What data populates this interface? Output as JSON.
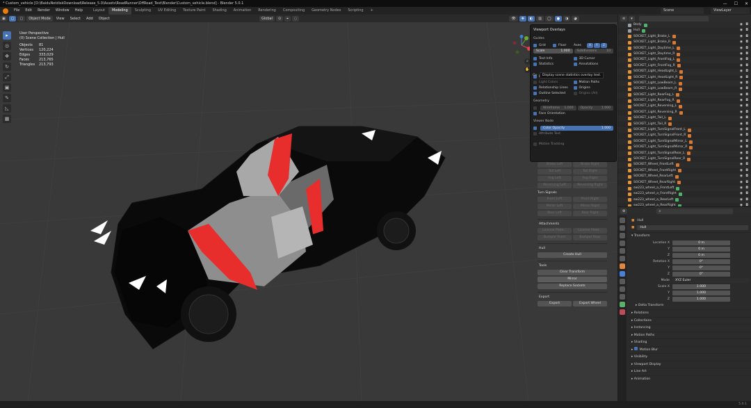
{
  "window": {
    "title": "* Custom_vehicle [D:\\BaiduNetdiskDownload\\Release_5.0\\Assets\\RoadRunner\\OffRoad_Test\\Blender\\Custom_vehicle.blend] - Blender 5.0.1",
    "minimize": "—",
    "maximize": "☐",
    "close": "✕"
  },
  "menu": [
    "File",
    "Edit",
    "Render",
    "Window",
    "Help"
  ],
  "workspaces": [
    "Layout",
    "Modeling",
    "Sculpting",
    "UV Editing",
    "Texture Paint",
    "Shading",
    "Animation",
    "Rendering",
    "Compositing",
    "Geometry Nodes",
    "Scripting"
  ],
  "active_workspace": "Modeling",
  "add_tab": "+",
  "scene": "Scene",
  "view_layer": "ViewLayer",
  "viewport_header": {
    "mode": "Object Mode",
    "menus": [
      "View",
      "Select",
      "Add",
      "Object"
    ],
    "orientation": "Global"
  },
  "stats": {
    "view": "User Perspective",
    "collection": "(0) Scene Collection | Hull",
    "rows": [
      {
        "k": "Objects",
        "v": "81"
      },
      {
        "k": "Vertices",
        "v": "120,224"
      },
      {
        "k": "Edges",
        "v": "333,029"
      },
      {
        "k": "Faces",
        "v": "213,765"
      },
      {
        "k": "Triangles",
        "v": "213,793"
      }
    ]
  },
  "tools": [
    "▸",
    "◎",
    "✥",
    "↻",
    "⤢",
    "▣",
    "✎",
    "◺",
    "▦"
  ],
  "overlays": {
    "title": "Viewport Overlays",
    "guides_label": "Guides",
    "grid": "Grid",
    "floor": "Floor",
    "axes": "Axes",
    "axis_x": "X",
    "axis_y": "Y",
    "axis_z": "Z",
    "scale_label": "Scale",
    "scale_value": "1.000",
    "subdivisions_label": "Subdivisions",
    "subdivisions_value": "10",
    "text_info": "Text Info",
    "cursor_3d": "3D Cursor",
    "statistics": "Statistics",
    "annotations": "Annotations",
    "extras": "Extras",
    "bones": "Bones",
    "light_colors": "Light Colors",
    "motion_paths": "Motion Paths",
    "relationship_lines": "Relationship Lines",
    "origins": "Origins",
    "outline_selected": "Outline Selected",
    "origins_all": "Origins (All)",
    "geometry_label": "Geometry",
    "wireframe_label": "Wireframe",
    "wireframe_value": "1.000",
    "opacity_label": "Opacity",
    "opacity_value": "1.000",
    "face_orientation": "Face Orientation",
    "viewer_node_label": "Viewer Node",
    "color_opacity_label": "Color Opacity",
    "color_opacity_value": "1.000",
    "attribute_text": "Attribute Text",
    "motion_tracking": "Motion Tracking",
    "tooltip_prefix": "Ov",
    "tooltip": "Display scene statistics overlay text."
  },
  "npanel": {
    "lights_rows": [
      [
        "Brake Left",
        "Brake Right"
      ],
      [
        "Tail Left",
        "Tail Right"
      ],
      [
        "Fog Left",
        "Fog Right"
      ],
      [
        "Reversing Left",
        "Reversing Right"
      ]
    ],
    "turn_signals_label": "Turn Signals",
    "turn_rows": [
      [
        "Front Left",
        "Front Right"
      ],
      [
        "Mirror Left",
        "Mirror Right"
      ],
      [
        "Rear Left",
        "Rear Right"
      ]
    ],
    "attachments_label": "Attachments",
    "attach_rows": [
      [
        "License Plate...",
        "License Plate..."
      ],
      [
        "Bumper Front",
        "Bumper Rear"
      ]
    ],
    "hull_label": "Hull",
    "create_hull": "Create Hull",
    "tools_label": "Tools",
    "clear_transform": "Clear Transform",
    "mirror": "Mirror",
    "replace_sockets": "Replace Sockets",
    "export_label": "Export",
    "export": "Export",
    "export_wheel": "Export Wheel"
  },
  "outliner": {
    "search_placeholder": "",
    "items": [
      {
        "name": "Body",
        "icon": "grey",
        "extra": "green"
      },
      {
        "name": "Hull",
        "icon": "grey",
        "extra": "green"
      },
      {
        "name": "SOCKET_Light_Brake_L",
        "icon": "orange"
      },
      {
        "name": "SOCKET_Light_Brake_R",
        "icon": "orange"
      },
      {
        "name": "SOCKET_Light_Daytime_L",
        "icon": "orange"
      },
      {
        "name": "SOCKET_Light_Daytime_R",
        "icon": "orange"
      },
      {
        "name": "SOCKET_Light_FrontFog_L",
        "icon": "orange"
      },
      {
        "name": "SOCKET_Light_FrontFog_R",
        "icon": "orange"
      },
      {
        "name": "SOCKET_Light_HeadLight_L",
        "icon": "orange"
      },
      {
        "name": "SOCKET_Light_HeadLight_R",
        "icon": "orange"
      },
      {
        "name": "SOCKET_Light_LowBeam_L",
        "icon": "orange"
      },
      {
        "name": "SOCKET_Light_LowBeam_R",
        "icon": "orange"
      },
      {
        "name": "SOCKET_Light_RearFog_L",
        "icon": "orange"
      },
      {
        "name": "SOCKET_Light_RearFog_R",
        "icon": "orange"
      },
      {
        "name": "SOCKET_Light_Reversing_L",
        "icon": "orange"
      },
      {
        "name": "SOCKET_Light_Reversing_R",
        "icon": "orange"
      },
      {
        "name": "SOCKET_Light_Tail_L",
        "icon": "orange"
      },
      {
        "name": "SOCKET_Light_Tail_R",
        "icon": "orange"
      },
      {
        "name": "SOCKET_Light_TurnSignalFront_L",
        "icon": "orange"
      },
      {
        "name": "SOCKET_Light_TurnSignalFront_R",
        "icon": "orange"
      },
      {
        "name": "SOCKET_Light_TurnSignalMirror_L",
        "icon": "orange"
      },
      {
        "name": "SOCKET_Light_TurnSignalMirror_R",
        "icon": "orange"
      },
      {
        "name": "SOCKET_Light_TurnSignalRear_L",
        "icon": "orange"
      },
      {
        "name": "SOCKET_Light_TurnSignalRear_R",
        "icon": "orange"
      },
      {
        "name": "SOCKET_Wheel_FrontLeft",
        "icon": "orange"
      },
      {
        "name": "SOCKET_Wheel_FrontRight",
        "icon": "orange"
      },
      {
        "name": "SOCKET_Wheel_RearLeft",
        "icon": "orange"
      },
      {
        "name": "SOCKET_Wheel_RearRight",
        "icon": "orange"
      },
      {
        "name": "sw223_wheel_a_FrontLeft",
        "icon": "orange",
        "extra": "green"
      },
      {
        "name": "sw223_wheel_a_FrontRight",
        "icon": "orange",
        "extra": "green"
      },
      {
        "name": "sw223_wheel_a_RearLeft",
        "icon": "orange",
        "extra": "green"
      },
      {
        "name": "sw223_wheel_a_RearRight",
        "icon": "orange",
        "extra": "green"
      }
    ]
  },
  "properties": {
    "object_name": "Hull",
    "data_name": "Hull",
    "transform_label": "Transform",
    "location_x_label": "Location X",
    "y_label": "Y",
    "z_label": "Z",
    "location_x": "0 m",
    "location_y": "0 m",
    "location_z": "0 m",
    "rotation_x_label": "Rotation X",
    "rotation_x": "0°",
    "rotation_y": "0°",
    "rotation_z": "0°",
    "mode_label": "Mode",
    "mode_value": "XYZ Euler",
    "scale_x_label": "Scale X",
    "scale_x": "1.000",
    "scale_y": "1.000",
    "scale_z": "1.000",
    "delta_transform": "Delta Transform",
    "sections": [
      "Relations",
      "Collections",
      "Instancing",
      "Motion Paths",
      "Shading",
      "Motion Blur",
      "Visibility",
      "Viewport Display",
      "Line Art",
      "Animation"
    ]
  },
  "version": "5.0.1",
  "colors": {
    "accent": "#4772b3",
    "bg": "#393939",
    "highlight_red": "#e82d2d"
  }
}
